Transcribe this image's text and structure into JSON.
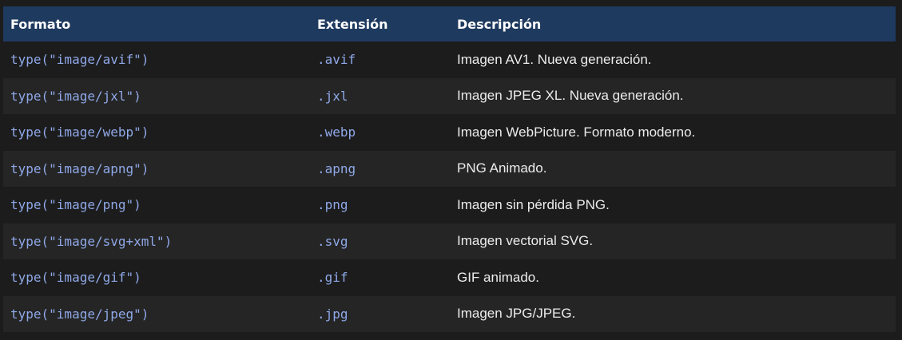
{
  "table": {
    "headers": {
      "format": "Formato",
      "extension": "Extensión",
      "description": "Descripción"
    },
    "rows": [
      {
        "format": "type(\"image/avif\")",
        "extension": ".avif",
        "description": "Imagen AV1. Nueva generación."
      },
      {
        "format": "type(\"image/jxl\")",
        "extension": ".jxl",
        "description": "Imagen JPEG XL. Nueva generación."
      },
      {
        "format": "type(\"image/webp\")",
        "extension": ".webp",
        "description": "Imagen WebPicture. Formato moderno."
      },
      {
        "format": "type(\"image/apng\")",
        "extension": ".apng",
        "description": "PNG Animado."
      },
      {
        "format": "type(\"image/png\")",
        "extension": ".png",
        "description": "Imagen sin pérdida PNG."
      },
      {
        "format": "type(\"image/svg+xml\")",
        "extension": ".svg",
        "description": "Imagen vectorial SVG."
      },
      {
        "format": "type(\"image/gif\")",
        "extension": ".gif",
        "description": "GIF animado."
      },
      {
        "format": "type(\"image/jpeg\")",
        "extension": ".jpg",
        "description": "Imagen JPG/JPEG."
      }
    ]
  },
  "colors": {
    "header_bg": "#1f3a5f",
    "code_text": "#8fa8e8",
    "row_odd": "#1c1c1c",
    "row_even": "#252525"
  }
}
